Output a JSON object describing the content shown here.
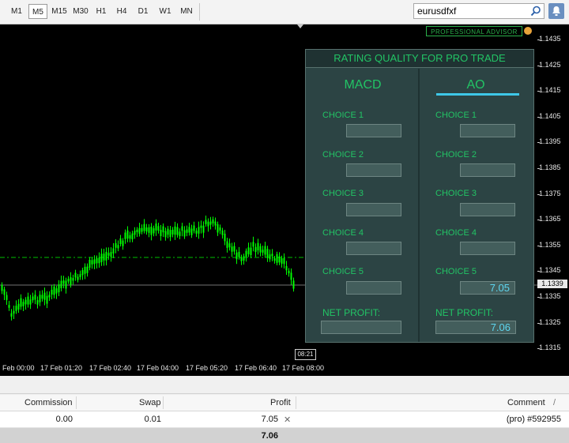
{
  "toolbar": {
    "timeframes": [
      "M1",
      "M5",
      "M15",
      "M30",
      "H1",
      "H4",
      "D1",
      "W1",
      "MN"
    ],
    "active_timeframe": "M5",
    "search_value": "eurusdfxf",
    "search_icon": "search-icon",
    "alert_icon": "bell-icon"
  },
  "chart": {
    "advisor_label": "PROFESSIONAL ADVISOR",
    "advisor_icon": "smiley-icon",
    "price_labels": [
      "1.1435",
      "1.1425",
      "1.1415",
      "1.1405",
      "1.1395",
      "1.1385",
      "1.1375",
      "1.1365",
      "1.1355",
      "1.1345",
      "1.1335",
      "1.1325",
      "1.1315"
    ],
    "current_price": "1.1339",
    "time_labels": [
      "Feb 00:00",
      "17 Feb 01:20",
      "17 Feb 02:40",
      "17 Feb 04:00",
      "17 Feb 05:20",
      "17 Feb 06:40",
      "17 Feb 08:00"
    ],
    "current_time": "08:21",
    "colors": {
      "candle": "#00ff00",
      "background": "#000000",
      "grid_line": "#00c000"
    }
  },
  "panel": {
    "title": "RATING QUALITY FOR PRO TRADE",
    "columns": [
      {
        "title": "MACD",
        "choices": [
          {
            "label": "CHOICE 1",
            "value": ""
          },
          {
            "label": "CHOICE 2",
            "value": ""
          },
          {
            "label": "CHOICE 3",
            "value": ""
          },
          {
            "label": "CHOICE 4",
            "value": ""
          },
          {
            "label": "CHOICE 5",
            "value": ""
          }
        ],
        "net_label": "NET PROFIT:",
        "net_value": ""
      },
      {
        "title": "AO",
        "choices": [
          {
            "label": "CHOICE 1",
            "value": ""
          },
          {
            "label": "CHOICE 2",
            "value": ""
          },
          {
            "label": "CHOICE 3",
            "value": ""
          },
          {
            "label": "CHOICE 4",
            "value": ""
          },
          {
            "label": "CHOICE 5",
            "value": "7.05"
          }
        ],
        "net_label": "NET PROFIT:",
        "net_value": "7.06"
      }
    ],
    "colors": {
      "background": "#2c4444",
      "text": "#22c465",
      "value": "#5dd6f0",
      "accent": "#3ec8e8"
    }
  },
  "terminal": {
    "headers": {
      "commission": "Commission",
      "swap": "Swap",
      "profit": "Profit",
      "comment": "Comment",
      "sort": "/"
    },
    "row": {
      "commission": "0.00",
      "swap": "0.01",
      "profit": "7.05",
      "comment": "(pro) #592955"
    },
    "close_icon": "close-icon",
    "total_profit": "7.06"
  }
}
